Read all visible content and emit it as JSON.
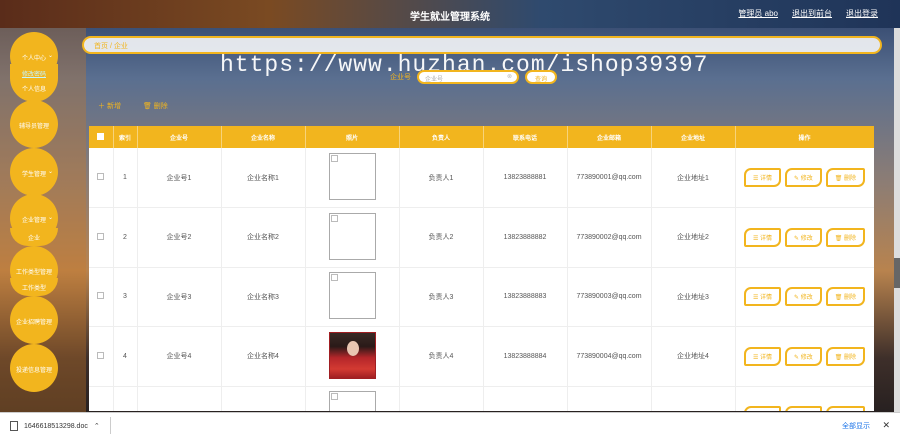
{
  "app": {
    "title": "学生就业管理系统",
    "admin_link": "管理员 abo",
    "backend_link": "退出到前台",
    "logout_link": "退出登录"
  },
  "sidebar": {
    "menus": [
      {
        "label": "个人中心",
        "sub": [
          "修改密码",
          "个人信息"
        ]
      },
      {
        "label": "辅导员管理"
      },
      {
        "label": "学生管理"
      },
      {
        "label": "企业管理",
        "sub": [
          "企业"
        ]
      },
      {
        "label": "工作类型管理",
        "sub": [
          "工作类型"
        ]
      },
      {
        "label": "企业招聘管理"
      },
      {
        "label": "投递信息管理"
      }
    ]
  },
  "breadcrumb": {
    "home": "首页",
    "sep": "/",
    "current": "企业"
  },
  "watermark": "https://www.huzhan.com/ishop39397",
  "search": {
    "label": "企业号",
    "placeholder": "企业号",
    "button": "查询"
  },
  "actions": {
    "add": "新增",
    "delete": "删除"
  },
  "table": {
    "headers": [
      "索引",
      "企业号",
      "企业名称",
      "照片",
      "负责人",
      "联系电话",
      "企业邮箱",
      "企业地址",
      "操作"
    ],
    "rows": [
      {
        "idx": "1",
        "no": "企业号1",
        "name": "企业名称1",
        "manager": "负责人1",
        "phone": "13823888881",
        "email": "773890001@qq.com",
        "addr": "企业地址1",
        "photo": "broken"
      },
      {
        "idx": "2",
        "no": "企业号2",
        "name": "企业名称2",
        "manager": "负责人2",
        "phone": "13823888882",
        "email": "773890002@qq.com",
        "addr": "企业地址2",
        "photo": "broken"
      },
      {
        "idx": "3",
        "no": "企业号3",
        "name": "企业名称3",
        "manager": "负责人3",
        "phone": "13823888883",
        "email": "773890003@qq.com",
        "addr": "企业地址3",
        "photo": "broken"
      },
      {
        "idx": "4",
        "no": "企业号4",
        "name": "企业名称4",
        "manager": "负责人4",
        "phone": "13823888884",
        "email": "773890004@qq.com",
        "addr": "企业地址4",
        "photo": "real"
      }
    ],
    "op_labels": {
      "detail": "详情",
      "edit": "修改",
      "delete": "删除"
    }
  },
  "download": {
    "file": "1646618513298.doc",
    "show_all": "全部显示"
  },
  "colors": {
    "accent": "#f2b51e"
  }
}
